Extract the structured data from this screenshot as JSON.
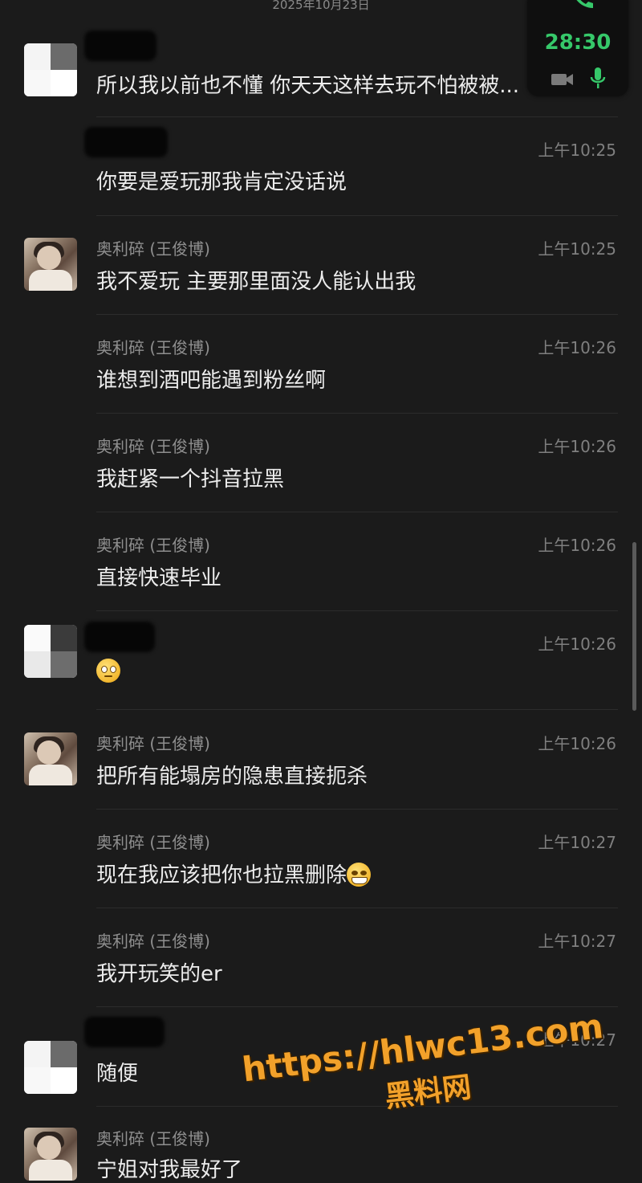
{
  "header": {
    "date": "2025年10月23日"
  },
  "call": {
    "timer": "28:30",
    "accent": "#36c86a"
  },
  "messages": [
    {
      "sender": "",
      "time": "",
      "text": "所以我以前也不懂 你天天这样去玩不怕被被..."
    },
    {
      "sender": "",
      "time": "上午10:25",
      "text": "你要是爱玩那我肯定没话说"
    },
    {
      "sender": "奥利碎 (王俊博)",
      "time": "上午10:25",
      "text": "我不爱玩 主要那里面没人能认出我"
    },
    {
      "sender": "奥利碎 (王俊博)",
      "time": "上午10:26",
      "text": "谁想到酒吧能遇到粉丝啊"
    },
    {
      "sender": "奥利碎 (王俊博)",
      "time": "上午10:26",
      "text": "我赶紧一个抖音拉黑"
    },
    {
      "sender": "奥利碎 (王俊博)",
      "time": "上午10:26",
      "text": "直接快速毕业"
    },
    {
      "sender": "",
      "time": "上午10:26",
      "text": "",
      "emoji": "flushed-face"
    },
    {
      "sender": "奥利碎 (王俊博)",
      "time": "上午10:26",
      "text": "把所有能塌房的隐患直接扼杀"
    },
    {
      "sender": "奥利碎 (王俊博)",
      "time": "上午10:27",
      "text": "现在我应该把你也拉黑删除",
      "emoji": "grimacing-face"
    },
    {
      "sender": "奥利碎 (王俊博)",
      "time": "上午10:27",
      "text": "我开玩笑的er"
    },
    {
      "sender": "",
      "time": "上午10:27",
      "text": "随便"
    },
    {
      "sender": "奥利碎 (王俊博)",
      "time": "",
      "text": "宁姐对我最好了"
    }
  ],
  "watermark": {
    "url": "https://hlwc13.com",
    "name": "黑料网"
  }
}
